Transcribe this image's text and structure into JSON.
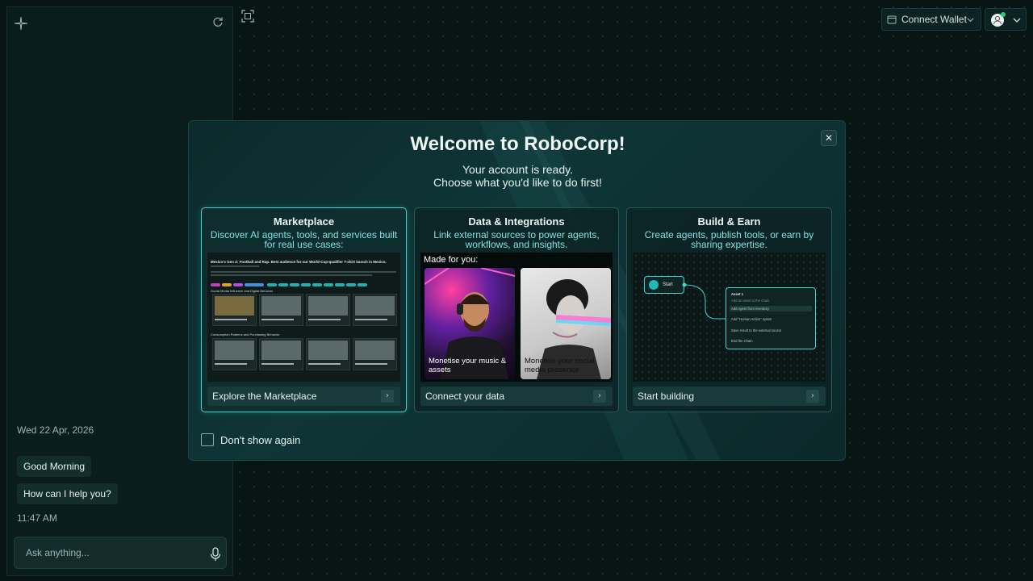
{
  "sidebar": {
    "date": "Wed 22 Apr, 2026",
    "messages": [
      "Good Morning",
      "How can I help you?"
    ],
    "time": "11:47 AM",
    "ask_placeholder": "Ask anything..."
  },
  "topbar": {
    "wallet_label": "Connect Wallet"
  },
  "modal": {
    "title": "Welcome to RoboCorp!",
    "subtitle_line1": "Your account is ready.",
    "subtitle_line2": "Choose what you'd like to do first!",
    "close_glyph": "✕",
    "dont_show": "Don't show again",
    "cards": [
      {
        "title": "Marketplace",
        "description": "Discover AI agents, tools, and services built for real use cases:",
        "button": "Explore the Marketplace",
        "preview": {
          "heading": "Mexico's Gen Z: Football and Rap. Best audience for our World-Cup-qualifier T-shirt launch in Mexico.",
          "sections": [
            "Social Media Influence and Digital Behavior",
            "Consumption Patterns and Purchasing Behavior"
          ]
        }
      },
      {
        "title": "Data & Integrations",
        "description": "Link external sources to power agents, workflows, and insights.",
        "button": "Connect your data",
        "preview": {
          "made_for_you": "Made for you:",
          "tiles": [
            "Monetise your music & assets",
            "Monetise your social media presence"
          ]
        }
      },
      {
        "title": "Build & Earn",
        "description": "Create agents, publish tools, or earn by sharing expertise.",
        "button": "Start building",
        "preview": {
          "start_label": "Start",
          "asset_title": "Asset 1",
          "asset_rows": [
            "Add an asset to the chain",
            "Add Agent from inventory",
            "Add \"Human Action\" option",
            "Save result to the external source",
            "End the Chain"
          ]
        }
      }
    ]
  },
  "colors": {
    "accent": "#3fd6d0",
    "background": "#081515",
    "online_dot": "#20d07a"
  },
  "icons": [
    "sparkle-logo-icon",
    "refresh-icon",
    "frame-scan-icon",
    "wallet-icon",
    "chevron-down-icon",
    "user-avatar-icon",
    "close-icon",
    "chevron-right-icon",
    "mic-icon",
    "play-icon"
  ]
}
